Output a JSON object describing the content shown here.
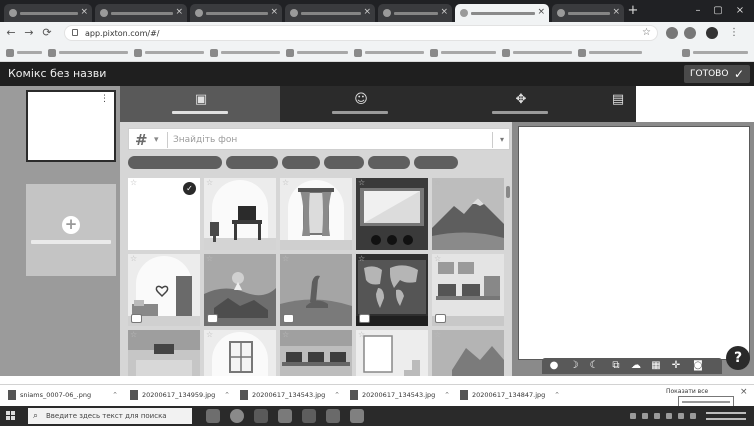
{
  "browser": {
    "tabs": [
      {
        "close": "×"
      },
      {
        "close": "×"
      },
      {
        "close": "×"
      },
      {
        "close": "×"
      },
      {
        "close": "×"
      },
      {
        "close": "×"
      },
      {
        "close": "×"
      }
    ],
    "active_tab_index": 5,
    "new_tab": "+",
    "window_controls": {
      "minimize": "–",
      "restore": "▢",
      "close": "×"
    },
    "nav": {
      "back": "←",
      "forward": "→",
      "reload": "⟳"
    },
    "url": "app.pixton.com/#/",
    "bookmark_count": 10
  },
  "app": {
    "title": "Комікс без назви",
    "done_label": "ГОТОВО",
    "done_icon": "✓"
  },
  "panels": {
    "menu_glyph": "⋮",
    "add_panel_glyph": "+",
    "add_panel_label": ""
  },
  "tool_tabs": [
    {
      "icon": "background-icon",
      "glyph": "▣",
      "label": "",
      "active": true
    },
    {
      "icon": "character-icon",
      "glyph": "☺",
      "label": "",
      "active": false
    },
    {
      "icon": "props-icon",
      "glyph": "✥",
      "label": "",
      "active": false
    },
    {
      "icon": "speech-bubble-icon",
      "glyph": "▤",
      "label": "",
      "active": false
    }
  ],
  "background_search": {
    "hash_glyph": "#",
    "caret": "▾",
    "placeholder": "Знайдіть фон",
    "value": "",
    "dropdown_glyph": "▾"
  },
  "tags": [
    "",
    "",
    "",
    "",
    "",
    ""
  ],
  "backgrounds": [
    {
      "scene": "blank",
      "selected": true
    },
    {
      "scene": "office-desk"
    },
    {
      "scene": "theater-window"
    },
    {
      "scene": "cinema-screen"
    },
    {
      "scene": "mountain"
    },
    {
      "scene": "bedroom-door"
    },
    {
      "scene": "bonfire-rocks"
    },
    {
      "scene": "dinosaur"
    },
    {
      "scene": "world-map"
    },
    {
      "scene": "computer-room"
    },
    {
      "scene": "living-room"
    },
    {
      "scene": "window-room"
    },
    {
      "scene": "office-desks"
    },
    {
      "scene": "stairs"
    },
    {
      "scene": "outdoor-rocks"
    }
  ],
  "canvas_tools": [
    "●",
    "☽",
    "☾",
    "⧉",
    "☁",
    "▦",
    "✛",
    "◙"
  ],
  "help_label": "?",
  "downloads": [
    {
      "name": "sniams_0007-06_.png",
      "chevron": "⌃"
    },
    {
      "name": "20200617_134959.jpg",
      "chevron": "⌃"
    },
    {
      "name": "20200617_134543.jpg",
      "chevron": "⌃"
    },
    {
      "name": "20200617_134543.jpg",
      "chevron": "⌃"
    },
    {
      "name": "20200617_134847.jpg",
      "chevron": "⌃"
    }
  ],
  "downloads_show_all": "Показати все",
  "downloads_close": "×",
  "taskbar": {
    "search_icon": "⌕",
    "search_placeholder": "Введите здесь текст для поиска"
  }
}
